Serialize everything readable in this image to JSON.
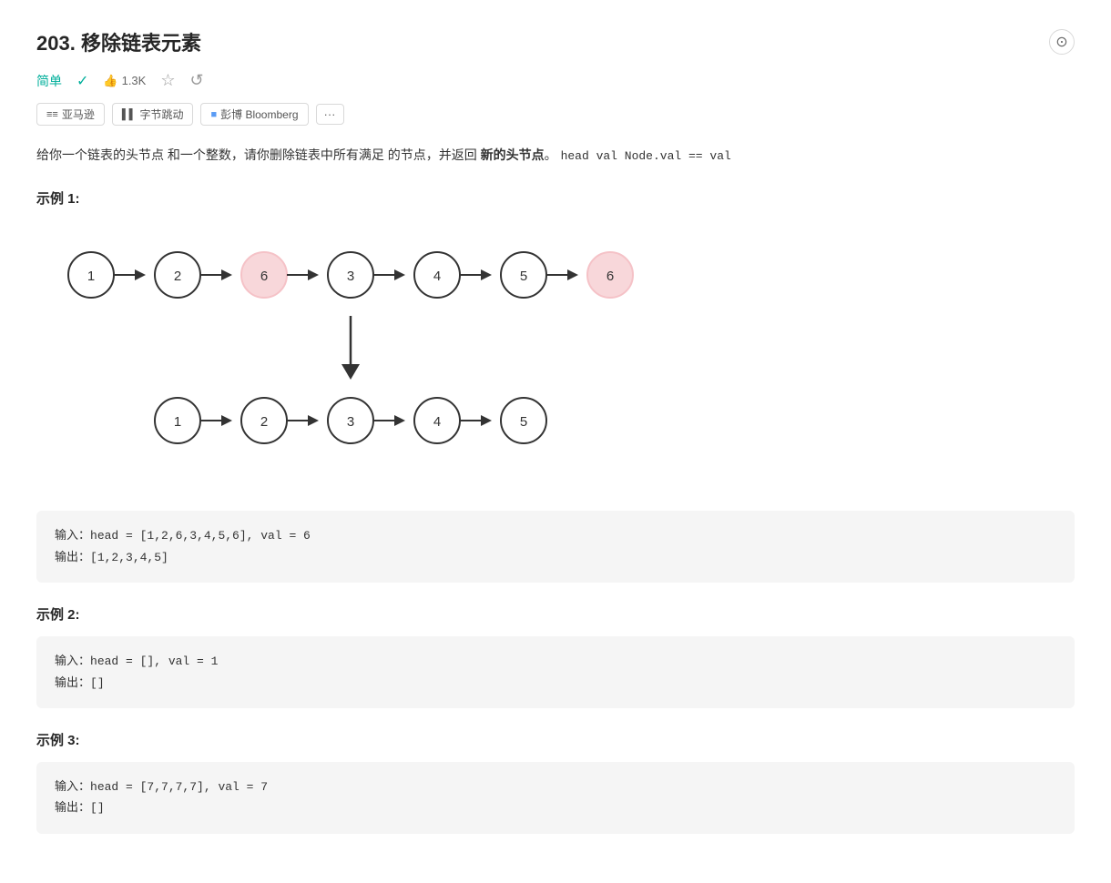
{
  "header": {
    "problem_number": "203.",
    "problem_title": "移除链表元素",
    "more_btn_label": "⊙"
  },
  "meta": {
    "difficulty": "简单",
    "likes_count": "1.3K",
    "check_icon": "✓",
    "star_icon": "☆",
    "refresh_icon": "↺"
  },
  "tags": [
    {
      "icon": "≡≡",
      "label": "亚马逊"
    },
    {
      "icon": "▌▌",
      "label": "字节跳动"
    },
    {
      "icon": "■",
      "label": "彭博 Bloomberg"
    }
  ],
  "more_tags_label": "···",
  "description_parts": {
    "prefix": "给你一个链表的头节点 和一个整数，请你删除链表中所有满足 的节点，并返回",
    "bold": "新的头节点",
    "suffix": "。",
    "code_part": "head  val  Node.val == val"
  },
  "example1": {
    "title": "示例 1:",
    "top_nodes": [
      {
        "value": "1",
        "highlighted": false
      },
      {
        "value": "2",
        "highlighted": false
      },
      {
        "value": "6",
        "highlighted": true
      },
      {
        "value": "3",
        "highlighted": false
      },
      {
        "value": "4",
        "highlighted": false
      },
      {
        "value": "5",
        "highlighted": false
      },
      {
        "value": "6",
        "highlighted": true
      }
    ],
    "bottom_nodes": [
      {
        "value": "1",
        "highlighted": false
      },
      {
        "value": "2",
        "highlighted": false
      },
      {
        "value": "3",
        "highlighted": false
      },
      {
        "value": "4",
        "highlighted": false
      },
      {
        "value": "5",
        "highlighted": false
      }
    ],
    "input_label": "输入：",
    "input_value": "head = [1,2,6,3,4,5,6], val = 6",
    "output_label": "输出：",
    "output_value": "[1,2,3,4,5]"
  },
  "example2": {
    "title": "示例 2:",
    "input_label": "输入：",
    "input_value": "head = [], val = 1",
    "output_label": "输出：",
    "output_value": "[]"
  },
  "example3": {
    "title": "示例 3:",
    "input_label": "输入：",
    "input_value": "head = [7,7,7,7], val = 7",
    "output_label": "输出：",
    "output_value": "[]"
  }
}
